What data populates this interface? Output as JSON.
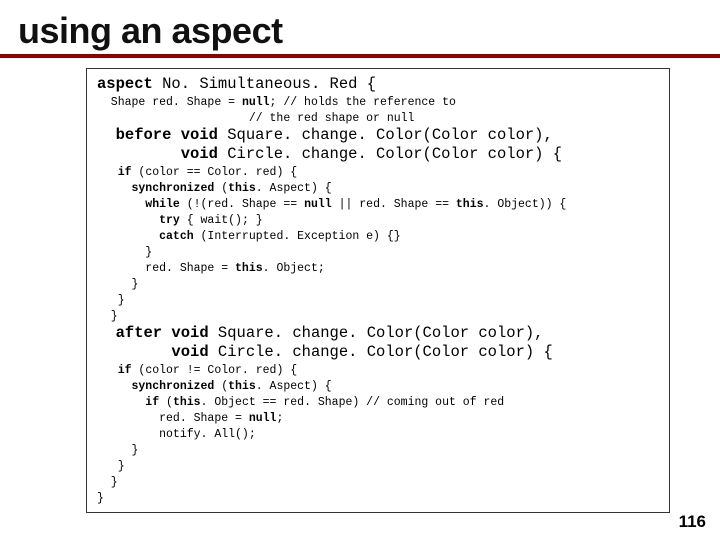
{
  "title": "using an aspect",
  "pagenum": "116",
  "code": {
    "l01a": "aspect",
    "l01b": " No. Simultaneous. Red {",
    "l02a": "  Shape red. Shape = ",
    "l02b": "null",
    "l02c": "; // holds the reference to",
    "l03": "                      // the red shape or null",
    "l04a": "  before void",
    "l04b": " Square. change. Color(Color color),",
    "l05a": "         void",
    "l05b": " Circle. change. Color(Color color) {",
    "l06a": "   if",
    "l06b": " (color == Color. red) {",
    "l07a": "     synchronized",
    "l07b": " (",
    "l07c": "this",
    "l07d": ". Aspect) {",
    "l08a": "       while",
    "l08b": " (!(red. Shape == ",
    "l08c": "null",
    "l08d": " || red. Shape == ",
    "l08e": "this",
    "l08f": ". Object)) {",
    "l09a": "         try",
    "l09b": " { wait(); }",
    "l10a": "         catch",
    "l10b": " (Interrupted. Exception e) {}",
    "l11": "       }",
    "l12a": "       red. Shape = ",
    "l12b": "this",
    "l12c": ". Object;",
    "l13": "     }",
    "l14": "   }",
    "l15": "  }",
    "l16a": "  after void",
    "l16b": " Square. change. Color(Color color),",
    "l17a": "        void",
    "l17b": " Circle. change. Color(Color color) {",
    "l18a": "   if",
    "l18b": " (color != Color. red) {",
    "l19a": "     synchronized",
    "l19b": " (",
    "l19c": "this",
    "l19d": ". Aspect) {",
    "l20a": "       if",
    "l20b": " (",
    "l20c": "this",
    "l20d": ". Object == red. Shape) // coming out of red",
    "l21a": "         red. Shape = ",
    "l21b": "null",
    "l21c": ";",
    "l22": "         notify. All();",
    "l23": "     }",
    "l24": "   }",
    "l25": "  }",
    "l26": "}"
  }
}
